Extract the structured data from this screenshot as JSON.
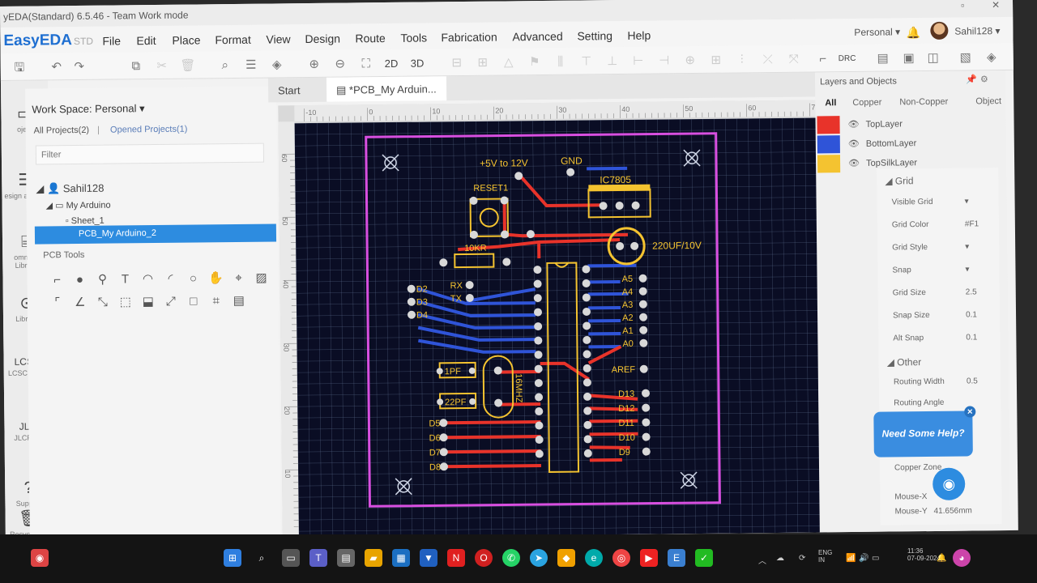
{
  "window": {
    "title": "yEDA(Standard) 6.5.46 - Team Work mode"
  },
  "app": {
    "logo": "EasyEDA",
    "edition": "STD"
  },
  "menu": [
    "File",
    "Edit",
    "Place",
    "Format",
    "View",
    "Design",
    "Route",
    "Tools",
    "Fabrication",
    "Advanced",
    "Setting",
    "Help"
  ],
  "user": {
    "workspace": "Personal",
    "name": "Sahil128"
  },
  "toolbar": {
    "view_2d": "2D",
    "view_3d": "3D",
    "drc": "DRC"
  },
  "rail": [
    {
      "label": "oject",
      "icon": "project-icon"
    },
    {
      "label": "esign anager",
      "icon": "design-manager-icon"
    },
    {
      "label": "ommon Library",
      "icon": "library-icon"
    },
    {
      "label": "Library",
      "icon": "search-library-icon"
    },
    {
      "label": "LCSC Parts",
      "icon": "lcsc-icon"
    },
    {
      "label": "JLCPCB",
      "icon": "jlcpcb-icon"
    },
    {
      "label": "Support",
      "icon": "support-icon"
    },
    {
      "label": "Recycle Bin",
      "icon": "trash-icon"
    }
  ],
  "left_panel": {
    "workspace_label": "Work Space: Personal",
    "tab_all": "All Projects(2)",
    "tab_opened": "Opened Projects(1)",
    "filter_placeholder": "Filter",
    "tree": {
      "user": "Sahil128",
      "project": "My Arduino",
      "sheet": "Sheet_1",
      "pcb": "PCB_My Arduino_2"
    },
    "pcb_tools_title": "PCB Tools"
  },
  "tabs": {
    "start": "Start",
    "active": "*PCB_My Arduin..."
  },
  "ruler": {
    "top": [
      "-10",
      "0",
      "10",
      "20",
      "30",
      "40",
      "50",
      "60",
      "70"
    ],
    "left": [
      "60",
      "50",
      "40",
      "30",
      "20",
      "10"
    ]
  },
  "pcb": {
    "labels": {
      "power": "+5V to 12V",
      "gnd": "GND",
      "regulator": "IC7805",
      "reset": "RESET1",
      "resistor": "10KR",
      "capacitor": "220UF/10V",
      "crystal": "16MHZ",
      "cap1": "1PF",
      "cap2": "22PF",
      "rx": "RX",
      "tx": "TX",
      "aref": "AREF"
    },
    "left_pins": [
      "D2",
      "D3",
      "D4"
    ],
    "analog_pins": [
      "A5",
      "A4",
      "A3",
      "A2",
      "A1",
      "A0"
    ],
    "digital_pins_right": [
      "D13",
      "D12",
      "D11",
      "D10",
      "D9"
    ],
    "digital_pins_left": [
      "D5",
      "D6",
      "D7",
      "D8"
    ],
    "colors": {
      "top_copper": "#e8332a",
      "bottom_copper": "#2f54d8",
      "silk": "#f4c330",
      "board_outline": "#d84fe0",
      "background": "#0a0d24",
      "grid": "#5a6b8a"
    }
  },
  "right_panel": {
    "title": "Layers and Objects",
    "tabs": [
      "All",
      "Copper",
      "Non-Copper",
      "Object"
    ],
    "layers": [
      {
        "name": "TopLayer",
        "color": "#e8332a"
      },
      {
        "name": "BottomLayer",
        "color": "#2f54d8"
      },
      {
        "name": "TopSilkLayer",
        "color": "#f4c330"
      }
    ],
    "grid_section": "Grid",
    "grid_props": [
      {
        "label": "Visible Grid",
        "value": ""
      },
      {
        "label": "Grid Color",
        "value": "#F1"
      },
      {
        "label": "Grid Style",
        "value": ""
      },
      {
        "label": "Snap",
        "value": ""
      },
      {
        "label": "Grid Size",
        "value": "2.5"
      },
      {
        "label": "Snap Size",
        "value": "0.1"
      },
      {
        "label": "Alt Snap",
        "value": "0.1"
      }
    ],
    "other_section": "Other",
    "other_props": [
      {
        "label": "Routing Width",
        "value": "0.5"
      },
      {
        "label": "Routing Angle",
        "value": ""
      },
      {
        "label": "Copper Zone",
        "value": ""
      },
      {
        "label": "Mouse-X",
        "value": ""
      },
      {
        "label": "Mouse-Y",
        "value": "41.656mm"
      }
    ],
    "help": "Need Some Help?"
  },
  "taskbar": {
    "lang": "ENG",
    "region": "IN",
    "time": "11:36",
    "date": "07-09-2024"
  }
}
